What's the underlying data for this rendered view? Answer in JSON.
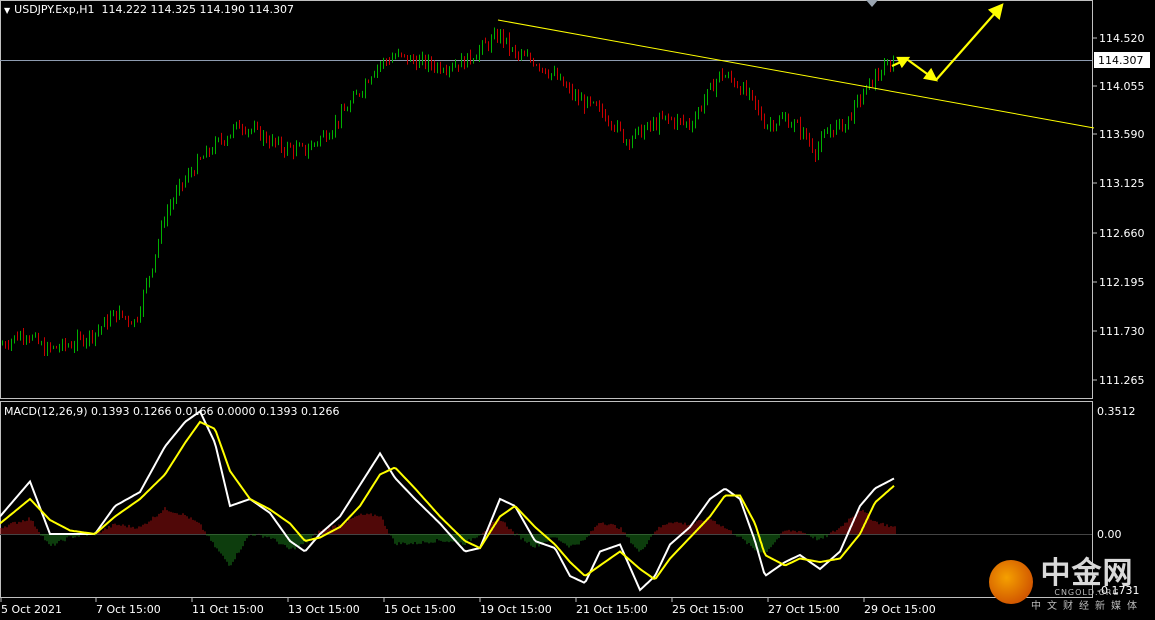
{
  "header": {
    "symbol": "USDJPY.Exp,H1",
    "ohlc": "114.222 114.325 114.190 114.307"
  },
  "price_axis": {
    "current_price": "114.307",
    "ticks": [
      "114.520",
      "114.055",
      "113.590",
      "113.125",
      "112.660",
      "112.195",
      "111.730",
      "111.265"
    ]
  },
  "macd": {
    "label": "MACD(12,26,9) 0.1393 0.1266 0.0166 0.0000 0.1393 0.1266",
    "axis_ticks": [
      "0.3512",
      "0.00",
      "-0.1731"
    ]
  },
  "time_axis": {
    "ticks": [
      "5 Oct 2021",
      "7 Oct 15:00",
      "11 Oct 15:00",
      "13 Oct 15:00",
      "15 Oct 15:00",
      "19 Oct 15:00",
      "21 Oct 15:00",
      "25 Oct 15:00",
      "27 Oct 15:00",
      "29 Oct 15:00"
    ]
  },
  "watermark": {
    "cn": "中金网",
    "en": "CNGOLD.ORG",
    "sub": "中文财经新媒体"
  },
  "colors": {
    "bull": "#00b000",
    "bear": "#c80000",
    "trendline": "#ffff00",
    "macd_main": "#ffffff",
    "macd_signal": "#ffff00"
  },
  "chart_data": {
    "type": "line",
    "title": "USDJPY.Exp,H1",
    "price_ylim": [
      111.05,
      114.9
    ],
    "path": [
      [
        0,
        111.6
      ],
      [
        25,
        111.72
      ],
      [
        45,
        111.55
      ],
      [
        70,
        111.6
      ],
      [
        95,
        111.72
      ],
      [
        115,
        111.9
      ],
      [
        135,
        111.82
      ],
      [
        150,
        112.3
      ],
      [
        165,
        112.85
      ],
      [
        180,
        113.1
      ],
      [
        195,
        113.3
      ],
      [
        215,
        113.5
      ],
      [
        240,
        113.7
      ],
      [
        260,
        113.6
      ],
      [
        280,
        113.48
      ],
      [
        305,
        113.45
      ],
      [
        330,
        113.65
      ],
      [
        355,
        113.95
      ],
      [
        375,
        114.25
      ],
      [
        395,
        114.35
      ],
      [
        415,
        114.3
      ],
      [
        440,
        114.25
      ],
      [
        465,
        114.3
      ],
      [
        485,
        114.45
      ],
      [
        500,
        114.55
      ],
      [
        515,
        114.35
      ],
      [
        535,
        114.3
      ],
      [
        555,
        114.15
      ],
      [
        575,
        113.95
      ],
      [
        595,
        113.85
      ],
      [
        610,
        113.75
      ],
      [
        625,
        113.55
      ],
      [
        645,
        113.65
      ],
      [
        665,
        113.75
      ],
      [
        690,
        113.7
      ],
      [
        705,
        113.95
      ],
      [
        720,
        114.18
      ],
      [
        735,
        114.1
      ],
      [
        750,
        113.95
      ],
      [
        765,
        113.7
      ],
      [
        785,
        113.75
      ],
      [
        800,
        113.65
      ],
      [
        815,
        113.45
      ],
      [
        830,
        113.65
      ],
      [
        845,
        113.7
      ],
      [
        860,
        113.95
      ],
      [
        875,
        114.15
      ],
      [
        895,
        114.31
      ]
    ],
    "macd_main": [
      [
        0,
        0.05
      ],
      [
        30,
        0.15
      ],
      [
        50,
        0.0
      ],
      [
        70,
        0.0
      ],
      [
        95,
        0.0
      ],
      [
        115,
        0.08
      ],
      [
        140,
        0.12
      ],
      [
        165,
        0.25
      ],
      [
        185,
        0.32
      ],
      [
        200,
        0.35
      ],
      [
        215,
        0.26
      ],
      [
        230,
        0.08
      ],
      [
        250,
        0.1
      ],
      [
        270,
        0.06
      ],
      [
        290,
        -0.02
      ],
      [
        305,
        -0.05
      ],
      [
        320,
        0.0
      ],
      [
        340,
        0.05
      ],
      [
        360,
        0.14
      ],
      [
        380,
        0.23
      ],
      [
        395,
        0.16
      ],
      [
        415,
        0.1
      ],
      [
        440,
        0.03
      ],
      [
        465,
        -0.05
      ],
      [
        480,
        -0.04
      ],
      [
        500,
        0.1
      ],
      [
        515,
        0.08
      ],
      [
        535,
        -0.02
      ],
      [
        555,
        -0.04
      ],
      [
        570,
        -0.12
      ],
      [
        585,
        -0.14
      ],
      [
        600,
        -0.05
      ],
      [
        620,
        -0.03
      ],
      [
        640,
        -0.16
      ],
      [
        655,
        -0.12
      ],
      [
        670,
        -0.03
      ],
      [
        690,
        0.02
      ],
      [
        710,
        0.1
      ],
      [
        725,
        0.13
      ],
      [
        740,
        0.1
      ],
      [
        755,
        -0.02
      ],
      [
        765,
        -0.12
      ],
      [
        785,
        -0.08
      ],
      [
        800,
        -0.06
      ],
      [
        820,
        -0.1
      ],
      [
        840,
        -0.05
      ],
      [
        860,
        0.08
      ],
      [
        875,
        0.13
      ],
      [
        895,
        0.16
      ]
    ],
    "macd_signal": [
      [
        0,
        0.03
      ],
      [
        30,
        0.1
      ],
      [
        50,
        0.04
      ],
      [
        70,
        0.01
      ],
      [
        95,
        0.0
      ],
      [
        115,
        0.05
      ],
      [
        140,
        0.1
      ],
      [
        165,
        0.17
      ],
      [
        185,
        0.26
      ],
      [
        200,
        0.32
      ],
      [
        215,
        0.3
      ],
      [
        230,
        0.18
      ],
      [
        250,
        0.1
      ],
      [
        270,
        0.07
      ],
      [
        290,
        0.03
      ],
      [
        305,
        -0.02
      ],
      [
        320,
        -0.01
      ],
      [
        340,
        0.02
      ],
      [
        360,
        0.08
      ],
      [
        380,
        0.17
      ],
      [
        395,
        0.19
      ],
      [
        415,
        0.13
      ],
      [
        440,
        0.05
      ],
      [
        465,
        -0.02
      ],
      [
        480,
        -0.04
      ],
      [
        500,
        0.05
      ],
      [
        515,
        0.08
      ],
      [
        535,
        0.02
      ],
      [
        555,
        -0.03
      ],
      [
        570,
        -0.08
      ],
      [
        585,
        -0.12
      ],
      [
        600,
        -0.09
      ],
      [
        620,
        -0.05
      ],
      [
        640,
        -0.1
      ],
      [
        655,
        -0.13
      ],
      [
        670,
        -0.07
      ],
      [
        690,
        -0.01
      ],
      [
        710,
        0.05
      ],
      [
        725,
        0.11
      ],
      [
        740,
        0.11
      ],
      [
        755,
        0.03
      ],
      [
        765,
        -0.06
      ],
      [
        785,
        -0.09
      ],
      [
        800,
        -0.07
      ],
      [
        820,
        -0.08
      ],
      [
        840,
        -0.07
      ],
      [
        860,
        0.0
      ],
      [
        875,
        0.09
      ],
      [
        895,
        0.14
      ]
    ]
  }
}
